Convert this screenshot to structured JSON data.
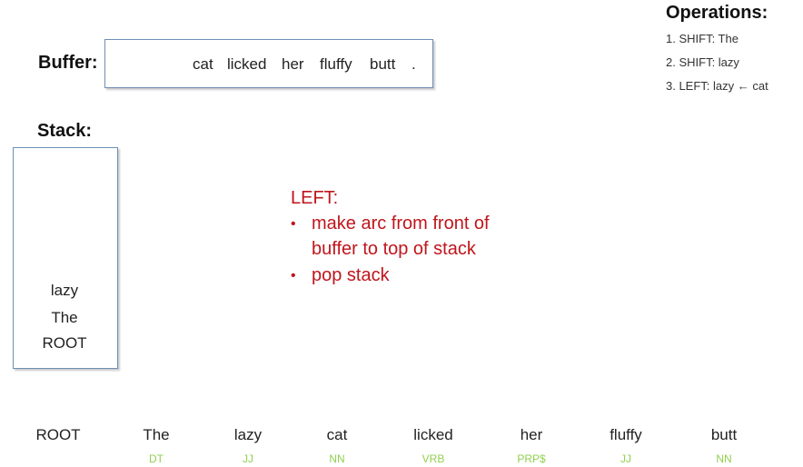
{
  "buffer": {
    "label": "Buffer:",
    "words": [
      "cat",
      "licked",
      "her",
      "fluffy",
      "butt",
      "."
    ]
  },
  "stack": {
    "label": "Stack:",
    "items": [
      "lazy",
      "The",
      "ROOT"
    ]
  },
  "operations": {
    "title": "Operations:",
    "items": [
      "1. SHIFT: The",
      "2. SHIFT: lazy",
      "3. LEFT: lazy ← cat"
    ]
  },
  "rule": {
    "title": "LEFT:",
    "bullets": [
      [
        "make arc from front of",
        "buffer to top of stack"
      ],
      [
        "pop stack"
      ]
    ],
    "bullet_glyph": "•",
    "color": "#c0151b"
  },
  "tokens": [
    {
      "word": "ROOT",
      "tag": ""
    },
    {
      "word": "The",
      "tag": "DT"
    },
    {
      "word": "lazy",
      "tag": "JJ"
    },
    {
      "word": "cat",
      "tag": "NN"
    },
    {
      "word": "licked",
      "tag": "VRB"
    },
    {
      "word": "her",
      "tag": "PRP$"
    },
    {
      "word": "fluffy",
      "tag": "JJ"
    },
    {
      "word": "butt",
      "tag": "NN"
    }
  ],
  "colors": {
    "tag": "#92d050",
    "box_border": "#6e8fb5"
  }
}
